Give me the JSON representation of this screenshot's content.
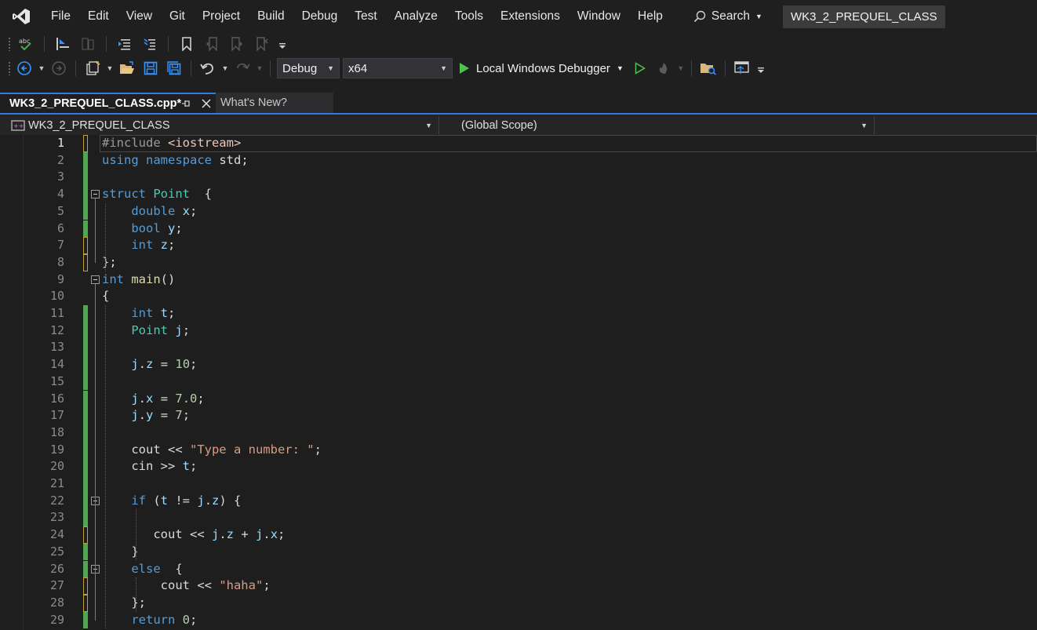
{
  "menubar": {
    "logo": "visual-studio-logo-icon",
    "items": [
      {
        "label": "File"
      },
      {
        "label": "Edit"
      },
      {
        "label": "View"
      },
      {
        "label": "Git"
      },
      {
        "label": "Project"
      },
      {
        "label": "Build"
      },
      {
        "label": "Debug"
      },
      {
        "label": "Test"
      },
      {
        "label": "Analyze"
      },
      {
        "label": "Tools"
      },
      {
        "label": "Extensions"
      },
      {
        "label": "Window"
      },
      {
        "label": "Help"
      }
    ],
    "search_label": "Search",
    "solution_name": "WK3_2_PREQUEL_CLASS"
  },
  "toolbar": {
    "configuration": "Debug",
    "platform": "x64",
    "debugger_label": "Local Windows Debugger"
  },
  "tabs": [
    {
      "label": "WK3_2_PREQUEL_CLASS.cpp*",
      "active": true
    },
    {
      "label": "What's New?",
      "active": false
    }
  ],
  "navbar": {
    "project": "WK3_2_PREQUEL_CLASS",
    "scope": "(Global Scope)"
  },
  "editor": {
    "current_line": 1,
    "colors": {
      "keyword": "#569cd6",
      "type": "#4ec9b0",
      "function": "#dcdcaa",
      "variable": "#9cdcfe",
      "number": "#b5cea8",
      "string": "#d69d85",
      "saved_change": "#4fa84f",
      "unsaved_change": "#bfa13b"
    },
    "lines": [
      {
        "n": "1",
        "text": "#include <iostream>"
      },
      {
        "n": "2",
        "text": "using namespace std;"
      },
      {
        "n": "3",
        "text": ""
      },
      {
        "n": "4",
        "text": "struct Point  {"
      },
      {
        "n": "5",
        "text": "    double x;"
      },
      {
        "n": "6",
        "text": "    bool y;"
      },
      {
        "n": "7",
        "text": "    int z;"
      },
      {
        "n": "8",
        "text": "};"
      },
      {
        "n": "9",
        "text": "int main()"
      },
      {
        "n": "10",
        "text": "{"
      },
      {
        "n": "11",
        "text": "    int t;"
      },
      {
        "n": "12",
        "text": "    Point j;"
      },
      {
        "n": "13",
        "text": ""
      },
      {
        "n": "14",
        "text": "    j.z = 10;"
      },
      {
        "n": "15",
        "text": ""
      },
      {
        "n": "16",
        "text": "    j.x = 7.0;"
      },
      {
        "n": "17",
        "text": "    j.y = 7;"
      },
      {
        "n": "18",
        "text": ""
      },
      {
        "n": "19",
        "text": "    cout << \"Type a number: \";"
      },
      {
        "n": "20",
        "text": "    cin >> t;"
      },
      {
        "n": "21",
        "text": ""
      },
      {
        "n": "22",
        "text": "    if (t != j.z) {"
      },
      {
        "n": "23",
        "text": ""
      },
      {
        "n": "24",
        "text": "       cout << j.z + j.x;"
      },
      {
        "n": "25",
        "text": "    }"
      },
      {
        "n": "26",
        "text": "    else  {"
      },
      {
        "n": "27",
        "text": "        cout << \"haha\";"
      },
      {
        "n": "28",
        "text": "    };"
      },
      {
        "n": "29",
        "text": "    return 0;"
      }
    ]
  }
}
